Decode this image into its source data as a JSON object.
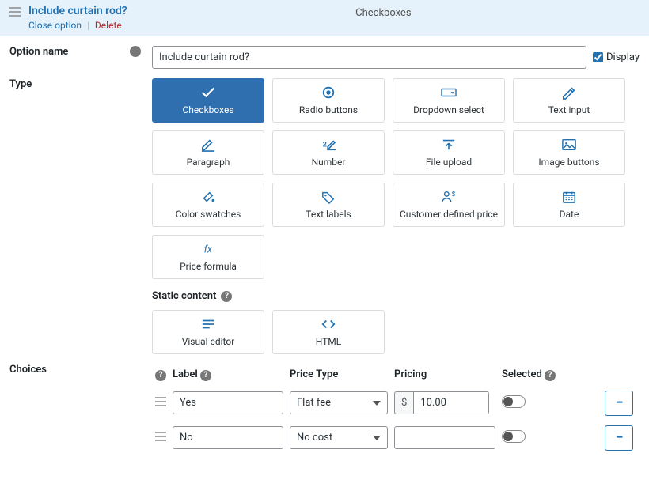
{
  "header": {
    "title": "Include curtain rod?",
    "center": "Checkboxes",
    "close": "Close option",
    "delete": "Delete"
  },
  "option": {
    "label": "Option name",
    "value": "Include curtain rod?",
    "display_label": "Display"
  },
  "type": {
    "label": "Type",
    "static_label": "Static content",
    "items": [
      "Checkboxes",
      "Radio buttons",
      "Dropdown select",
      "Text input",
      "Paragraph",
      "Number",
      "File upload",
      "Image buttons",
      "Color swatches",
      "Text labels",
      "Customer defined price",
      "Date",
      "Price formula"
    ],
    "static_items": [
      "Visual editor",
      "HTML"
    ]
  },
  "choices": {
    "label": "Choices",
    "cols": {
      "label": "Label",
      "price_type": "Price Type",
      "pricing": "Pricing",
      "selected": "Selected"
    },
    "rows": [
      {
        "label": "Yes",
        "price_type": "Flat fee",
        "currency": "$",
        "price": "10.00"
      },
      {
        "label": "No",
        "price_type": "No cost",
        "currency": "",
        "price": ""
      }
    ]
  }
}
